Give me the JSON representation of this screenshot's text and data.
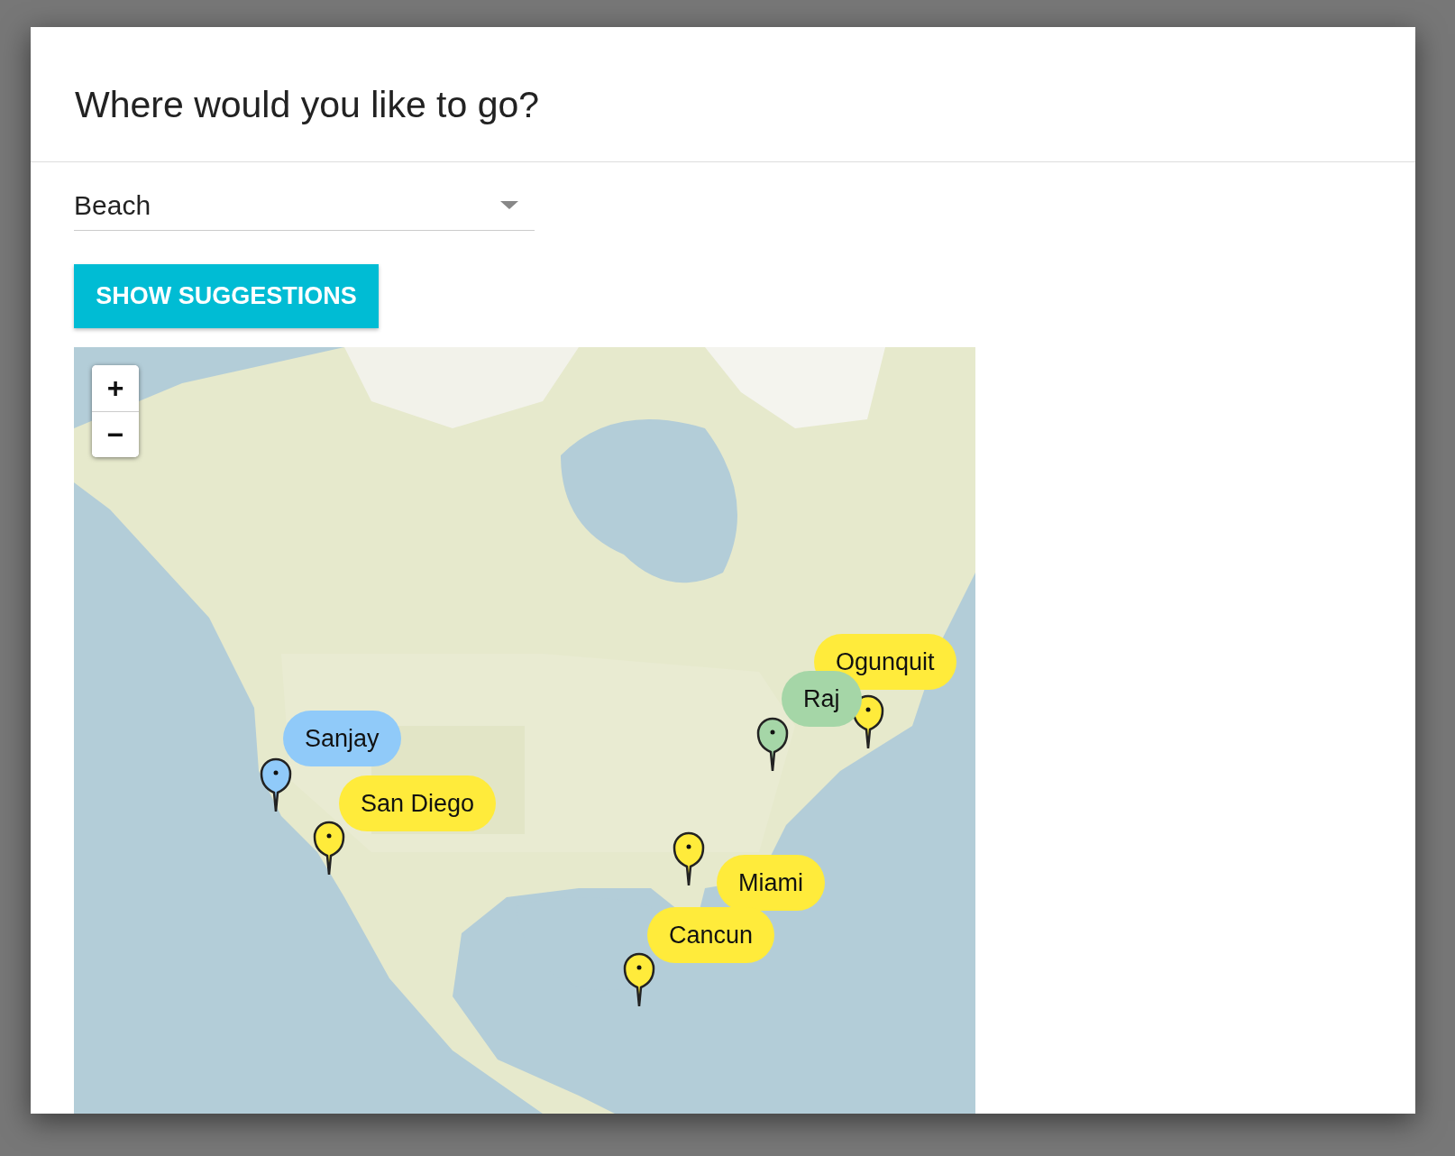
{
  "dialog": {
    "title": "Where would you like to go?"
  },
  "select": {
    "value": "Beach"
  },
  "button": {
    "label": "SHOW SUGGESTIONS"
  },
  "map": {
    "kind": "picture",
    "zoom_controls": [
      "+",
      "−"
    ],
    "markers": [
      {
        "label": "Ogunquit",
        "color": "#ffeb3b"
      },
      {
        "label": "Raj",
        "color": "#a5d6a7"
      },
      {
        "label": "Sanjay",
        "color": "#90caf9"
      },
      {
        "label": "San Diego",
        "color": "#ffeb3b"
      },
      {
        "label": "Miami",
        "color": "#ffeb3b"
      },
      {
        "label": "Cancun",
        "color": "#ffeb3b"
      }
    ]
  }
}
